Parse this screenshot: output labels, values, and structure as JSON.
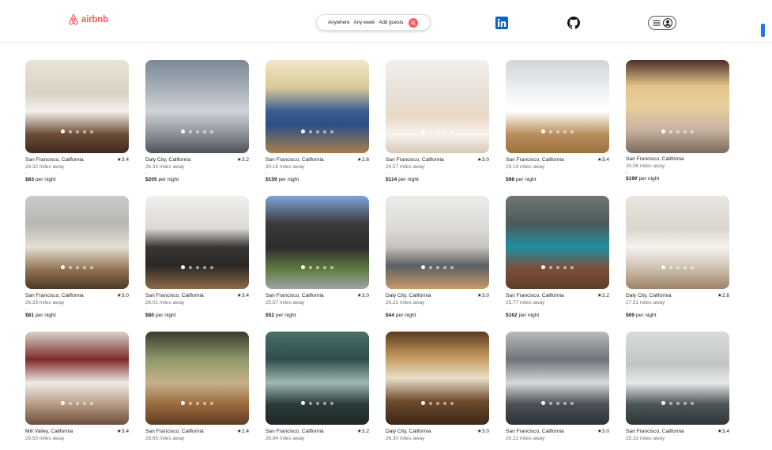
{
  "header": {
    "logo_text": "airbnb",
    "brand_color": "#ff5a5f",
    "search": {
      "anywhere": "Anywhere",
      "any_week": "Any week",
      "add_guests": "Add guests"
    }
  },
  "listings": [
    {
      "location": "San Francisco, California",
      "rating": "★3.4",
      "distance": "28.32 miles away",
      "dash": "-",
      "price": "$83",
      "per": "per night"
    },
    {
      "location": "Daly City, California",
      "rating": "★3.2",
      "distance": "26.33 miles away",
      "dash": "-",
      "price": "$205",
      "per": "per night"
    },
    {
      "location": "San Francisco, California",
      "rating": "★2.6",
      "distance": "30.16 miles away",
      "dash": "-",
      "price": "$159",
      "per": "per night"
    },
    {
      "location": "San Francisco, California",
      "rating": "★3.0",
      "distance": "29.57 miles away",
      "dash": "-",
      "price": "$114",
      "per": "per night"
    },
    {
      "location": "San Francisco, California",
      "rating": "★3.4",
      "distance": "29.19 miles away",
      "dash": "-",
      "price": "$98",
      "per": "per night"
    },
    {
      "location": "San Francisco, California",
      "rating": "",
      "distance": "30.06 miles away",
      "dash": "-",
      "price": "$190",
      "per": "per night"
    },
    {
      "location": "San Francisco, California",
      "rating": "★3.0",
      "distance": "26.33 miles away",
      "dash": "-",
      "price": "$81",
      "per": "per night"
    },
    {
      "location": "San Francisco, California",
      "rating": "★3.4",
      "distance": "26.01 miles away",
      "dash": "-",
      "price": "$80",
      "per": "per night"
    },
    {
      "location": "San Francisco, California",
      "rating": "★3.0",
      "distance": "25.57 miles away",
      "dash": "-",
      "price": "$52",
      "per": "per night"
    },
    {
      "location": "Daly City, California",
      "rating": "★3.0",
      "distance": "26.21 miles away",
      "dash": "-",
      "price": "$44",
      "per": "per night"
    },
    {
      "location": "San Francisco, California",
      "rating": "★3.2",
      "distance": "25.77 miles away",
      "dash": "-",
      "price": "$162",
      "per": "per night"
    },
    {
      "location": "Daly City, California",
      "rating": "★2.8",
      "distance": "27.31 miles away",
      "dash": "-",
      "price": "$69",
      "per": "per night"
    },
    {
      "location": "Mill Valley, California",
      "rating": "★3.4",
      "distance": "29.50 miles away",
      "dash": "",
      "price": "",
      "per": ""
    },
    {
      "location": "San Francisco, California",
      "rating": "★2.4",
      "distance": "28.65 miles away",
      "dash": "",
      "price": "",
      "per": ""
    },
    {
      "location": "San Francisco, California",
      "rating": "★3.2",
      "distance": "26.84 miles away",
      "dash": "",
      "price": "",
      "per": ""
    },
    {
      "location": "Daly City, California",
      "rating": "★3.0",
      "distance": "26.30 miles away",
      "dash": "",
      "price": "",
      "per": ""
    },
    {
      "location": "San Francisco, California",
      "rating": "★3.0",
      "distance": "26.22 miles away",
      "dash": "",
      "price": "",
      "per": ""
    },
    {
      "location": "San Francisco, California",
      "rating": "★3.4",
      "distance": "25.32 miles away",
      "dash": "",
      "price": "",
      "per": ""
    }
  ]
}
